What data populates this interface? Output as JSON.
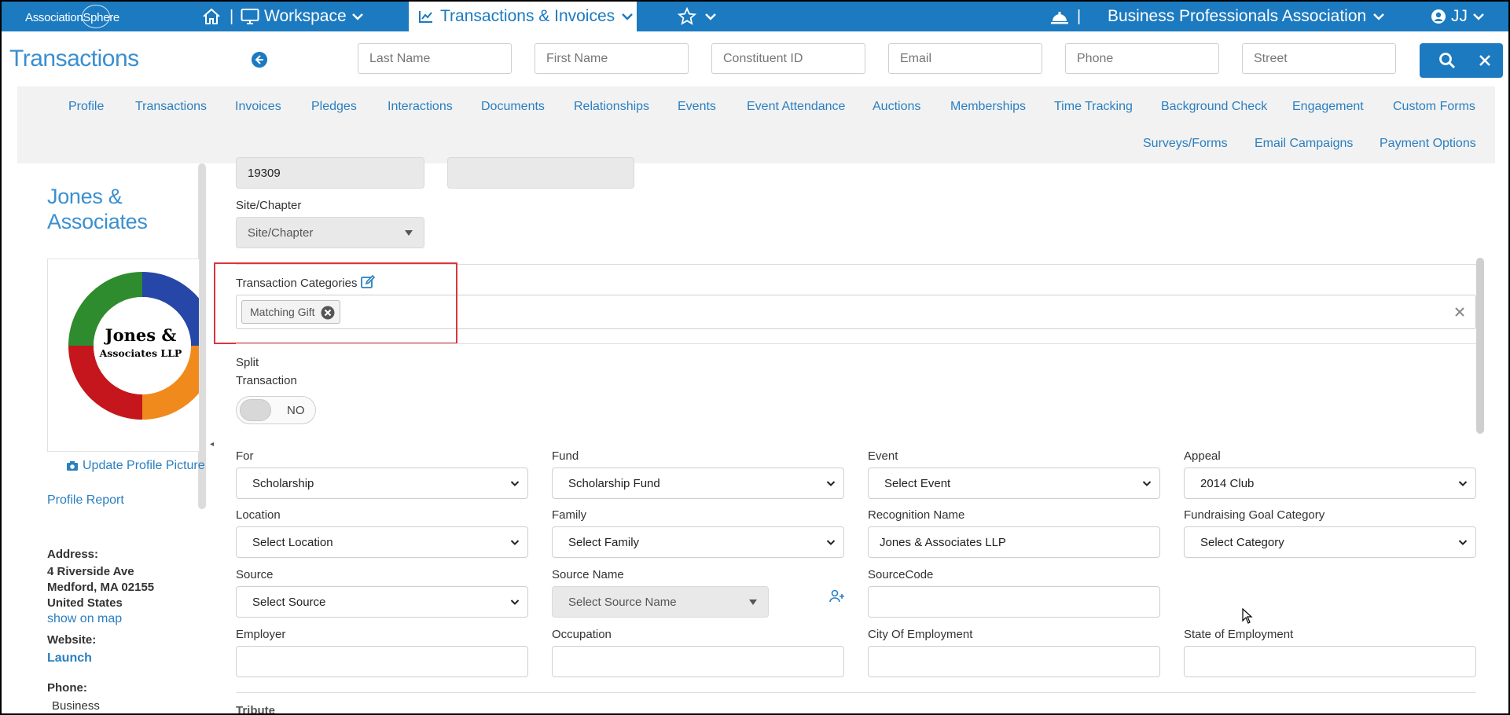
{
  "topbar": {
    "logo_text": "AssociationSphere",
    "sep": "|",
    "workspace": "Workspace",
    "module": "Transactions & Invoices",
    "org": "Business Professionals Association",
    "user": "JJ"
  },
  "page": {
    "title": "Transactions"
  },
  "search": {
    "last_name": "Last Name",
    "first_name": "First Name",
    "constituent_id": "Constituent ID",
    "email": "Email",
    "phone": "Phone",
    "street": "Street"
  },
  "tabs": [
    "Profile",
    "Transactions",
    "Invoices",
    "Pledges",
    "Interactions",
    "Documents",
    "Relationships",
    "Events",
    "Event Attendance",
    "Auctions",
    "Memberships",
    "Time Tracking",
    "Background Check",
    "Engagement",
    "Custom Forms",
    "Surveys/Forms",
    "Email Campaigns",
    "Payment Options"
  ],
  "sidebar": {
    "org_name": "Jones & Associates",
    "logo_line1": "Jones &",
    "logo_line2": "Associates LLP",
    "update_pic": "Update Profile Picture",
    "profile_report": "Profile Report",
    "address_label": "Address:",
    "address_line1": "4 Riverside Ave",
    "address_line2": "Medford, MA 02155",
    "address_line3": "United States",
    "show_map": "show on map",
    "website_label": "Website:",
    "website_link": "Launch",
    "phone_label": "Phone:",
    "phone_type": "Business"
  },
  "form": {
    "top_value": "19309",
    "site_label": "Site/Chapter",
    "site_value": "Site/Chapter",
    "categories_label": "Transaction Categories",
    "category_chip": "Matching Gift",
    "split_label_1": "Split",
    "split_label_2": "Transaction",
    "split_toggle": "NO",
    "for_label": "For",
    "for_value": "Scholarship",
    "fund_label": "Fund",
    "fund_value": "Scholarship Fund",
    "event_label": "Event",
    "event_value": "Select Event",
    "appeal_label": "Appeal",
    "appeal_value": "2014 Club",
    "location_label": "Location",
    "location_value": "Select Location",
    "family_label": "Family",
    "family_value": "Select Family",
    "recognition_label": "Recognition Name",
    "recognition_value": "Jones & Associates LLP",
    "goal_label": "Fundraising Goal Category",
    "goal_value": "Select Category",
    "source_label": "Source",
    "source_value": "Select Source",
    "source_name_label": "Source Name",
    "source_name_value": "Select Source Name",
    "sourcecode_label": "SourceCode",
    "sourcecode_value": "",
    "employer_label": "Employer",
    "occupation_label": "Occupation",
    "city_label": "City Of Employment",
    "state_label": "State of Employment",
    "tribute_label": "Tribute"
  },
  "colors": {
    "brand": "#1b7ac0",
    "link": "#2a7fc0",
    "highlight": "#d9363e"
  }
}
